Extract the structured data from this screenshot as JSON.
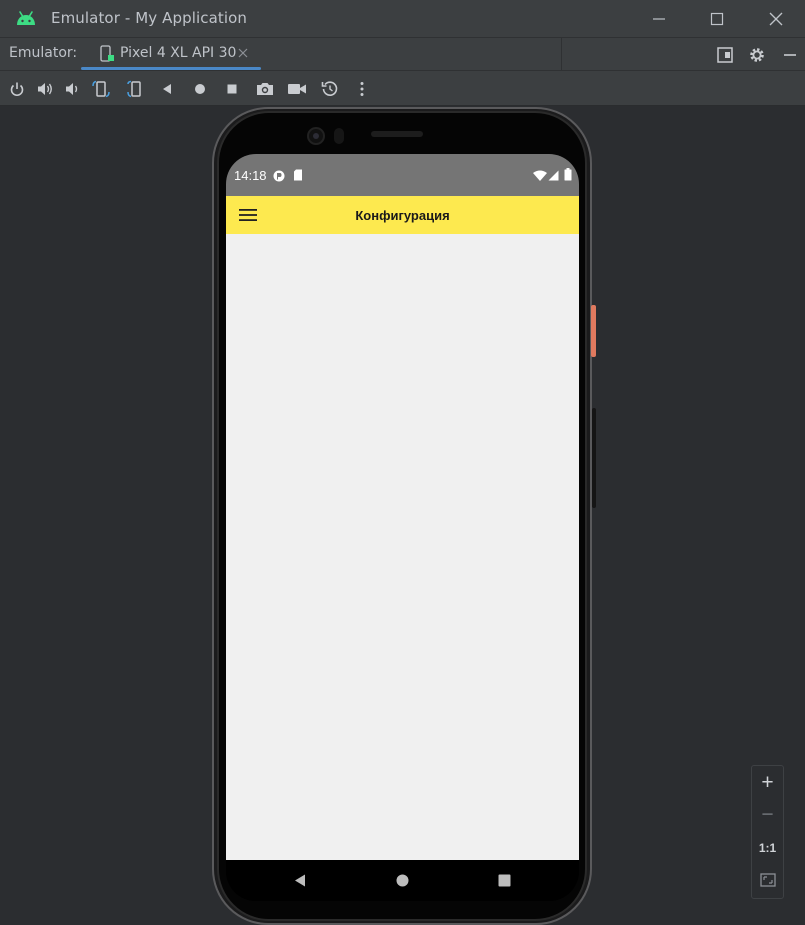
{
  "window": {
    "title": "Emulator - My Application",
    "icon": "android-icon",
    "controls": [
      "minimize-icon",
      "maximize-icon",
      "close-icon"
    ]
  },
  "tabbar": {
    "caption": "Emulator:",
    "active_tab": {
      "label": "Pixel 4 XL API 30",
      "icon": "device-icon",
      "close_icon": "close-icon"
    },
    "tools": [
      "snapshot-layout-icon",
      "gear-icon",
      "hide-icon"
    ]
  },
  "toolbar": {
    "tools": [
      "power-icon",
      "volume-up-icon",
      "volume-down-icon",
      "rotate-left-icon",
      "rotate-right-icon",
      "back-icon",
      "home-icon",
      "overview-icon",
      "camera-icon",
      "video-icon",
      "snapshot-restore-icon",
      "more-icon"
    ]
  },
  "device": {
    "status_bar": {
      "time": "14:18",
      "icons": [
        "notification-icon",
        "sd-card-icon",
        "wifi-icon",
        "signal-icon",
        "battery-icon"
      ]
    },
    "app_bar": {
      "title": "Конфигурация",
      "menu_icon": "hamburger-menu-icon"
    },
    "nav_bar": [
      "nav-back-icon",
      "nav-home-icon",
      "nav-recents-icon"
    ]
  },
  "zoom_panel": {
    "zoom_in": "+",
    "zoom_out": "−",
    "actual_size": "1:1",
    "fit_icon": "fit-screen-icon"
  },
  "colors": {
    "window_bg": "#2b2d30",
    "chrome_bg": "#3c3f41",
    "tab_accent": "#4a88c7",
    "status_bar": "#757575",
    "app_bar": "#fde94f",
    "content_bg": "#f0f0f0",
    "android_green": "#3ddc84"
  }
}
